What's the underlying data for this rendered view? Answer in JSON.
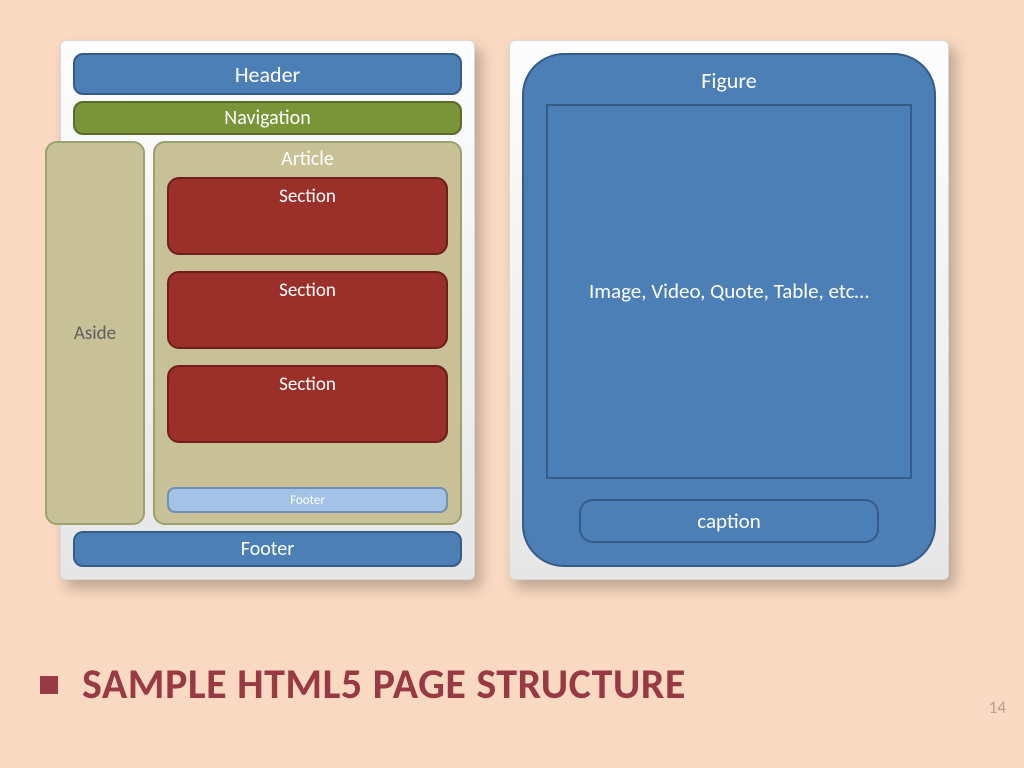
{
  "left": {
    "header": "Header",
    "navigation": "Navigation",
    "aside": "Aside",
    "article": "Article",
    "sections": [
      "Section",
      "Section",
      "Section"
    ],
    "inner_footer": "Footer",
    "footer": "Footer"
  },
  "right": {
    "figure": "Figure",
    "content": "Image, Video, Quote, Table, etc…",
    "caption": "caption"
  },
  "title": "SAMPLE HTML5 PAGE STRUCTURE",
  "page_number": "14"
}
